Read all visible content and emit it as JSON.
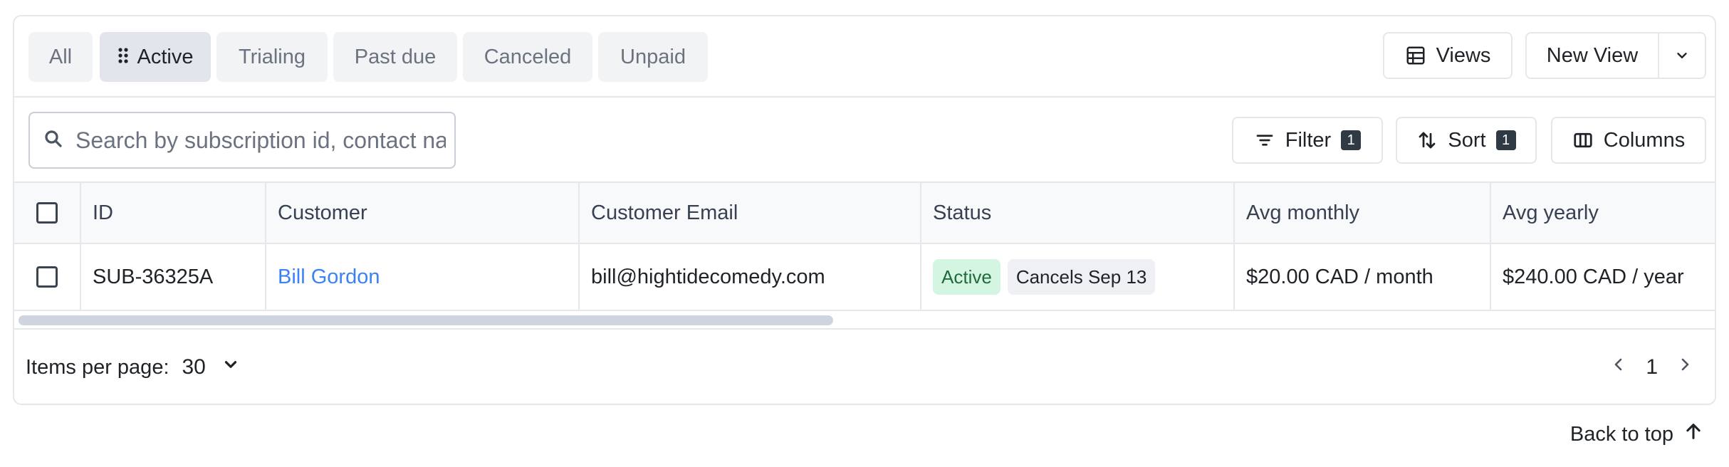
{
  "tabs": [
    {
      "label": "All"
    },
    {
      "label": "Active"
    },
    {
      "label": "Trialing"
    },
    {
      "label": "Past due"
    },
    {
      "label": "Canceled"
    },
    {
      "label": "Unpaid"
    }
  ],
  "header_actions": {
    "views_label": "Views",
    "new_view_label": "New View"
  },
  "search": {
    "placeholder": "Search by subscription id, contact name, or email"
  },
  "toolbar": {
    "filter_label": "Filter",
    "filter_count": "1",
    "sort_label": "Sort",
    "sort_count": "1",
    "columns_label": "Columns"
  },
  "table": {
    "columns": [
      "ID",
      "Customer",
      "Customer Email",
      "Status",
      "Avg monthly",
      "Avg yearly"
    ],
    "rows": [
      {
        "id": "SUB-36325A",
        "customer": "Bill Gordon",
        "email": "bill@hightidecomedy.com",
        "status": "Active",
        "status_note": "Cancels Sep 13",
        "avg_monthly": "$20.00 CAD / month",
        "avg_yearly": "$240.00 CAD / year"
      }
    ]
  },
  "pagination": {
    "items_per_page_label": "Items per page:",
    "items_per_page_value": "30",
    "current_page": "1"
  },
  "back_to_top_label": "Back to top",
  "colors": {
    "accent_link": "#3b82f6",
    "status_active_bg": "#d5f5e3",
    "status_active_text": "#1f6b3a"
  }
}
